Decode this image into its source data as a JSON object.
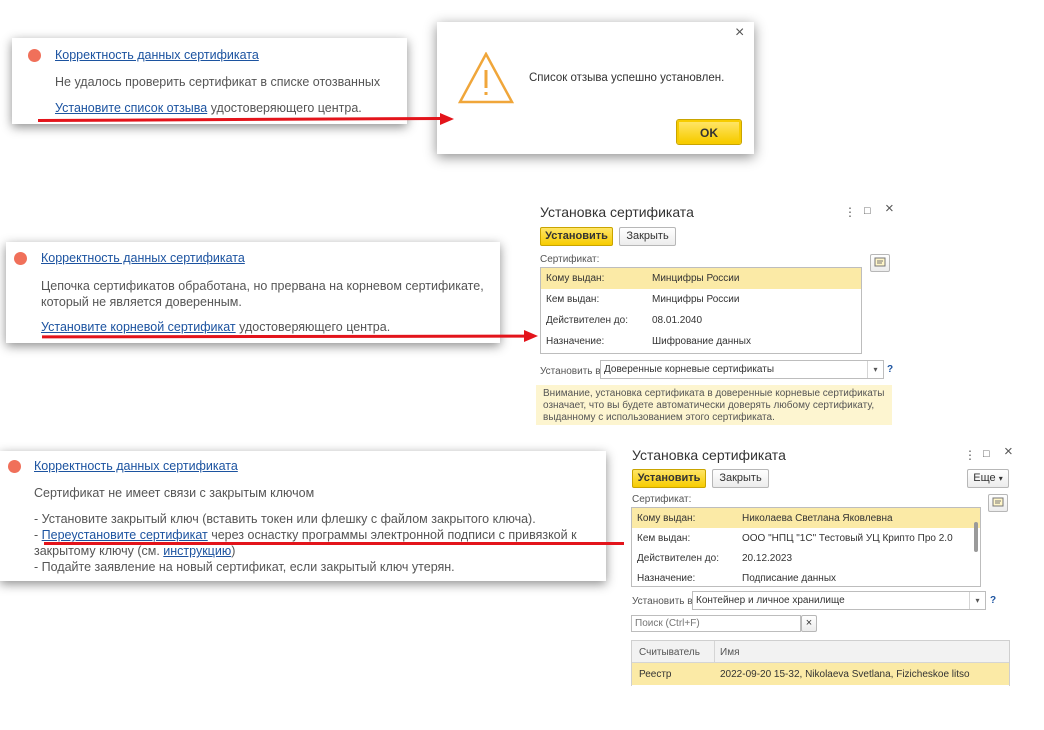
{
  "panel1": {
    "link": "Корректность данных сертификата",
    "text": "Не удалось проверить сертификат в списке отозванных",
    "action_link": "Установите список отзыва",
    "action_rest": " удостоверяющего центра."
  },
  "dialog1": {
    "message": "Список отзыва успешно установлен.",
    "ok": "OK",
    "close": "×"
  },
  "panel2": {
    "link": "Корректность данных сертификата",
    "text1": "Цепочка сертификатов обработана, но прервана на корневом сертификате,",
    "text2": "который не является доверенным.",
    "action_link": "Установите корневой сертификат",
    "action_rest": " удостоверяющего центра."
  },
  "window1": {
    "title": "Установка сертификата",
    "menu": "⋮",
    "maximize": "□",
    "close": "×",
    "install_btn": "Установить",
    "close_btn": "Закрыть",
    "cert_label": "Сертификат:",
    "rows": [
      {
        "key": "Кому выдан:",
        "value": "Минцифры России"
      },
      {
        "key": "Кем выдан:",
        "value": "Минцифры России"
      },
      {
        "key": "Действителен до:",
        "value": "08.01.2040"
      },
      {
        "key": "Назначение:",
        "value": "Шифрование данных"
      }
    ],
    "install_to_label": "Установить в:",
    "install_to_value": "Доверенные корневые сертификаты",
    "help": "?",
    "note1": "Внимание, установка сертификата в доверенные корневые сертификаты",
    "note2": "означает, что вы будете автоматически доверять любому сертификату,",
    "note3": "выданному с использованием этого сертификата."
  },
  "panel3": {
    "link": "Корректность данных сертификата",
    "text": "Сертификат не имеет связи с закрытым ключом",
    "line1": "- Установите закрытый ключ (вставить токен или флешку с файлом закрытого ключа).",
    "line2_prefix": "- ",
    "line2_link": "Переустановите сертификат",
    "line2_rest": " через оснастку программы электронной подписи с привязкой к",
    "line3_prefix": "закрытому ключу (см. ",
    "line3_link": "инструкцию",
    "line3_suffix": ")",
    "line4": "- Подайте заявление на новый сертификат, если закрытый ключ утерян."
  },
  "window2": {
    "title": "Установка сертификата",
    "menu": "⋮",
    "maximize": "□",
    "close": "×",
    "install_btn": "Установить",
    "close_btn": "Закрыть",
    "more_btn": "Еще",
    "cert_label": "Сертификат:",
    "rows": [
      {
        "key": "Кому выдан:",
        "value": "Николаева Светлана Яковлевна"
      },
      {
        "key": "Кем выдан:",
        "value": "ООО \"НПЦ \"1С\" Тестовый УЦ Крипто Про 2.0"
      },
      {
        "key": "Действителен до:",
        "value": "20.12.2023"
      },
      {
        "key": "Назначение:",
        "value": "Подписание данных"
      }
    ],
    "install_to_label": "Установить в:",
    "install_to_value": "Контейнер и личное хранилище",
    "help": "?",
    "search_placeholder": "Поиск (Ctrl+F)",
    "search_clear": "×",
    "columns": [
      "Считыватель",
      "Имя"
    ],
    "table_rows": [
      {
        "reader": "Реестр",
        "name": "2022-09-20 15-32, Nikolaeva Svetlana, Fizicheskoe litso"
      }
    ]
  }
}
